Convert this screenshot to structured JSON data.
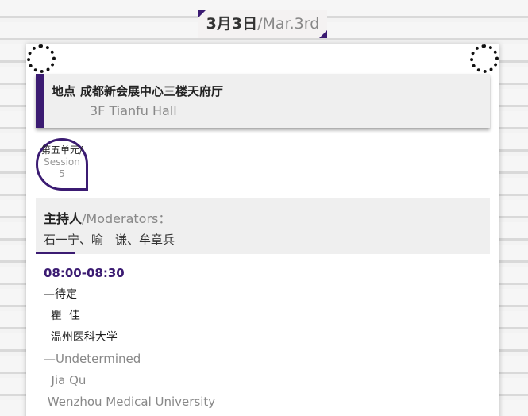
{
  "date": {
    "cn": "3月3日",
    "separator": "/",
    "en": "Mar.3rd"
  },
  "venue": {
    "label": "地点",
    "name_cn": "成都新会展中心三楼天府厅",
    "name_en": "3F Tianfu Hall"
  },
  "session": {
    "cn": "第五单元/",
    "en_line1": "Session",
    "en_line2": "5"
  },
  "moderators": {
    "label_cn": "主持人",
    "separator": "/",
    "label_en": "Moderators：",
    "names": "石一宁、喻　谦、牟章兵"
  },
  "schedule": [
    {
      "time": "08:00-08:30",
      "topic_cn": "—待定",
      "speaker_cn": "  瞿  佳",
      "affiliation_cn": "  温州医科大学",
      "topic_en": "—Undetermined",
      "speaker_en": "  Jia Qu",
      "affiliation_en": " Wenzhou Medical University"
    }
  ],
  "colors": {
    "accent": "#3b1b72",
    "panel": "#efefef",
    "muted_text": "#888888"
  }
}
